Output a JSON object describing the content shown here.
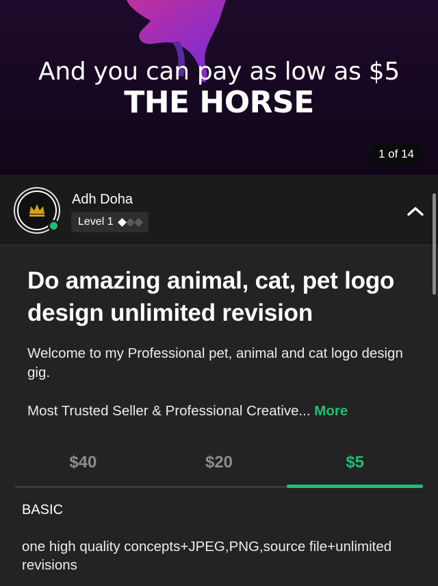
{
  "gallery": {
    "line1": "And you can pay as low as $5",
    "line2": "THE HORSE",
    "counter": "1 of 14"
  },
  "seller": {
    "name": "Adh Doha",
    "level": "Level 1",
    "online": true
  },
  "gig": {
    "title": "Do amazing animal, cat, pet logo design unlimited revision",
    "description": "Welcome to my Professional pet, animal and cat logo design gig.",
    "description2": "Most Trusted Seller & Professional Creative...",
    "more_label": "More"
  },
  "packages": {
    "tabs": [
      {
        "label": "$40",
        "active": false
      },
      {
        "label": "$20",
        "active": false
      },
      {
        "label": "$5",
        "active": true
      }
    ],
    "selected": {
      "name": "BASIC",
      "description": "one high quality concepts+JPEG,PNG,source file+unlimited revisions"
    }
  },
  "colors": {
    "accent": "#1dbf73",
    "background": "#232323",
    "hero_purple": "#b5279c"
  },
  "icons": {
    "collapse": "chevron-up-icon",
    "level": "diamond-icon"
  }
}
